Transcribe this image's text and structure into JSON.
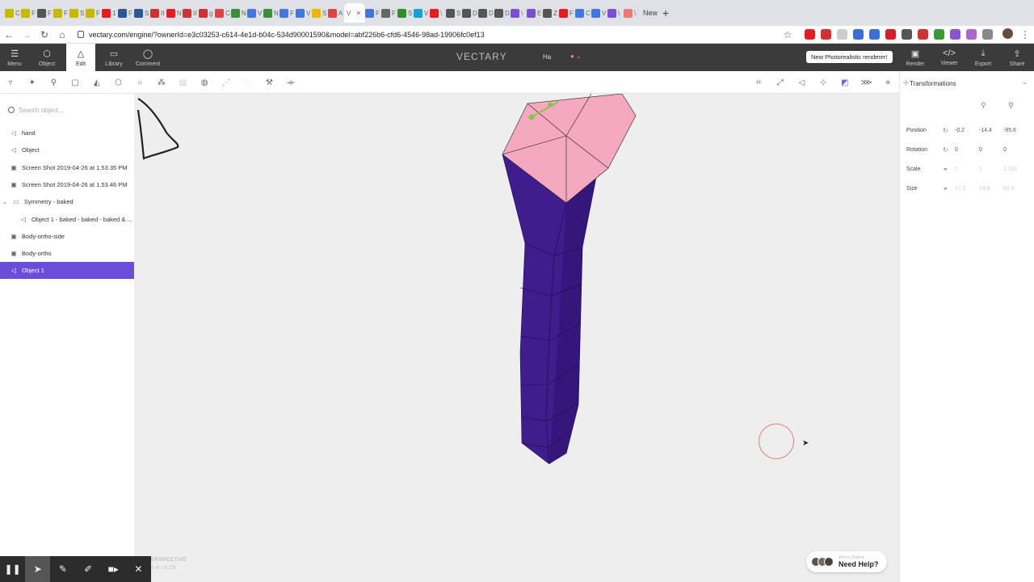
{
  "browser": {
    "tabs": [
      {
        "color": "#c6b700",
        "label": "C"
      },
      {
        "color": "#c6b700",
        "label": "F"
      },
      {
        "color": "#555555",
        "label": "F"
      },
      {
        "color": "#c6b700",
        "label": "F"
      },
      {
        "color": "#c6b700",
        "label": "S"
      },
      {
        "color": "#c6b700",
        "label": "F"
      },
      {
        "color": "#e02020",
        "label": "1"
      },
      {
        "color": "#2b5797",
        "label": "F"
      },
      {
        "color": "#2b5797",
        "label": "S"
      },
      {
        "color": "#cc3333",
        "label": "II"
      },
      {
        "color": "#e02020",
        "label": "N"
      },
      {
        "color": "#cc3333",
        "label": "II"
      },
      {
        "color": "#cc3333",
        "label": "g"
      },
      {
        "color": "#dd4444",
        "label": "C"
      },
      {
        "color": "#3a8f3a",
        "label": "N"
      },
      {
        "color": "#4477dd",
        "label": "V"
      },
      {
        "color": "#3a8f3a",
        "label": "N"
      },
      {
        "color": "#4477dd",
        "label": "F"
      },
      {
        "color": "#4477dd",
        "label": "V"
      },
      {
        "color": "#f0b400",
        "label": "S"
      },
      {
        "color": "#dd4444",
        "label": "A"
      }
    ],
    "active_tab_label": "V",
    "tabs_after": [
      {
        "color": "#4477dd",
        "label": "F"
      },
      {
        "color": "#666666",
        "label": "F"
      },
      {
        "color": "#2f8f2f",
        "label": "S"
      },
      {
        "color": "#1a9fd0",
        "label": "V"
      },
      {
        "color": "#e02020",
        "label": "\\"
      },
      {
        "color": "#555555",
        "label": "S"
      },
      {
        "color": "#555555",
        "label": "D"
      },
      {
        "color": "#555555",
        "label": "D"
      },
      {
        "color": "#555555",
        "label": "D"
      },
      {
        "color": "#7a4fd0",
        "label": "\\"
      },
      {
        "color": "#7a4fd0",
        "label": "E"
      },
      {
        "color": "#555555",
        "label": "Z"
      },
      {
        "color": "#e02020",
        "label": "F"
      },
      {
        "color": "#4477dd",
        "label": "C"
      },
      {
        "color": "#4477dd",
        "label": "V"
      },
      {
        "color": "#7a4fd0",
        "label": "\\"
      },
      {
        "color": "#ee7777",
        "label": "\\"
      }
    ],
    "new_tab_label": "New",
    "new_tab_button": "+",
    "url": "vectary.com/engine/?ownerId=e3c03253-c614-4e1d-b04c-534d90001590&model=abf226b6-cfd6-4546-98ad-19906fc0ef13",
    "back": "←",
    "forward": "→",
    "reload": "↻",
    "home": "⌂",
    "star": "☆",
    "extensions": [
      "#e02020",
      "#cc3333",
      "#cccccc",
      "#3b6fd6",
      "#3b6fd6",
      "#d0202a",
      "#555555",
      "#cc3333",
      "#3a9a3a",
      "#8855cc",
      "#aa66cc",
      "#888888"
    ],
    "menu_glyph": "⋮"
  },
  "toolbar": {
    "menu": {
      "label": "Menu",
      "icon": "☰"
    },
    "object": {
      "label": "Object",
      "icon": "⬡"
    },
    "edit": {
      "label": "Edit",
      "icon": "△"
    },
    "library": {
      "label": "Library",
      "icon": "▭"
    },
    "comment": {
      "label": "Comment",
      "icon": "◯"
    },
    "brand": "VECTARY",
    "doc_name": "Ha",
    "status_glyph": "● ⌄",
    "tooltip": "New Photorealistic renderer!",
    "render": {
      "label": "Render",
      "icon": "▣"
    },
    "viewer": {
      "label": "Viewer",
      "icon": "</>"
    },
    "export": {
      "label": "Export",
      "icon": "⤓"
    },
    "share": {
      "label": "Share",
      "icon": "⇪"
    }
  },
  "subtools": {
    "left": [
      "▿",
      "✦",
      "⚲",
      "▢",
      "◭",
      "⬡",
      "○",
      "⁂",
      "▤",
      "◍",
      "⋰",
      "⋱",
      "⚒",
      "⟛"
    ],
    "right": [
      "⌗",
      "⤢",
      "◁",
      "⊹",
      "◩",
      "⋙",
      "⋄"
    ]
  },
  "outliner": {
    "search_placeholder": "Search object...",
    "nodes": [
      {
        "icon": "◁",
        "label": "hand",
        "indent": 0
      },
      {
        "icon": "◁",
        "label": "Object",
        "indent": 0
      },
      {
        "icon": "▣",
        "label": "Screen Shot 2019-04-26 at 1.53.35 PM",
        "indent": 0
      },
      {
        "icon": "▣",
        "label": "Screen Shot 2019-04-26 at 1.53.46 PM",
        "indent": 0
      },
      {
        "icon": "▭",
        "label": "Symmetry - baked",
        "indent": 0,
        "toggle": "⌄"
      },
      {
        "icon": "◁",
        "label": "Object 1 - baked - baked - baked & ...",
        "indent": 1
      },
      {
        "icon": "▣",
        "label": "Body-ortho-side",
        "indent": 0
      },
      {
        "icon": "▣",
        "label": "Body-ortho",
        "indent": 0
      },
      {
        "icon": "◁",
        "label": "Object 1",
        "indent": 0,
        "selected": true
      }
    ]
  },
  "viewport": {
    "camera_label": "ERSPECTIVE",
    "stats": "1 ⬩0 ◇0 ▢0",
    "help_sub": "We're Online",
    "help_main": "Need Help?",
    "colors": {
      "top_face": "#f4a9c0",
      "body": "#3f1d8c",
      "body_dark": "#2e1270"
    }
  },
  "properties": {
    "title": "Transformations",
    "rows": [
      {
        "label": "Position",
        "icon": "↻",
        "values": [
          "-0.2",
          "-14.4",
          "-95.6"
        ],
        "dim": false
      },
      {
        "label": "Rotation",
        "icon": "↻",
        "values": [
          "0",
          "0",
          "0"
        ],
        "dim": false
      },
      {
        "label": "Scale",
        "icon": "⚭",
        "values": [
          "1",
          "1",
          "1.161"
        ],
        "dim": true
      },
      {
        "label": "Size",
        "icon": "⚭",
        "values": [
          "17.2",
          "14.6",
          "92.9"
        ],
        "dim": true
      }
    ]
  },
  "recorder": {
    "buttons": [
      "❚❚",
      "➤",
      "✎",
      "✐",
      "■▸",
      "✕"
    ]
  }
}
